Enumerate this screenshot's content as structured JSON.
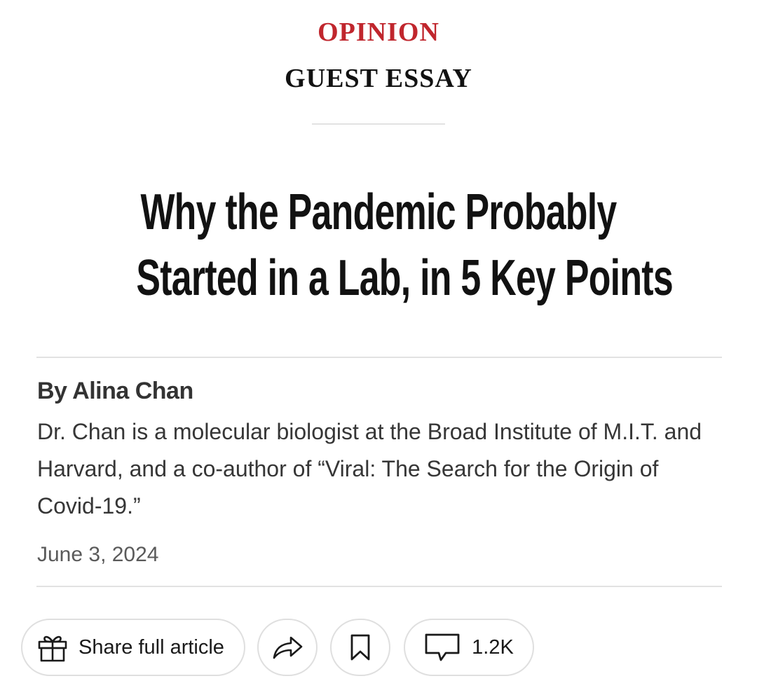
{
  "header": {
    "kicker": "OPINION",
    "section": "GUEST ESSAY"
  },
  "article": {
    "headline_lines": [
      "Why the Pandemic Probably",
      "Started in a Lab, in 5 Key Points"
    ],
    "byline": "By Alina Chan",
    "bio": "Dr. Chan is a molecular biologist at the Broad Institute of M.I.T. and Harvard, and a co-author of “Viral: The Search for the Origin of Covid-19.”",
    "date": "June 3, 2024"
  },
  "toolbar": {
    "share_label": "Share full article",
    "comment_count": "1.2K",
    "icons": [
      "gift-icon",
      "share-arrow-icon",
      "bookmark-icon",
      "comment-icon"
    ]
  },
  "colors": {
    "kicker": "#c0262d",
    "text": "#121212",
    "rule": "#e2e2e2"
  }
}
